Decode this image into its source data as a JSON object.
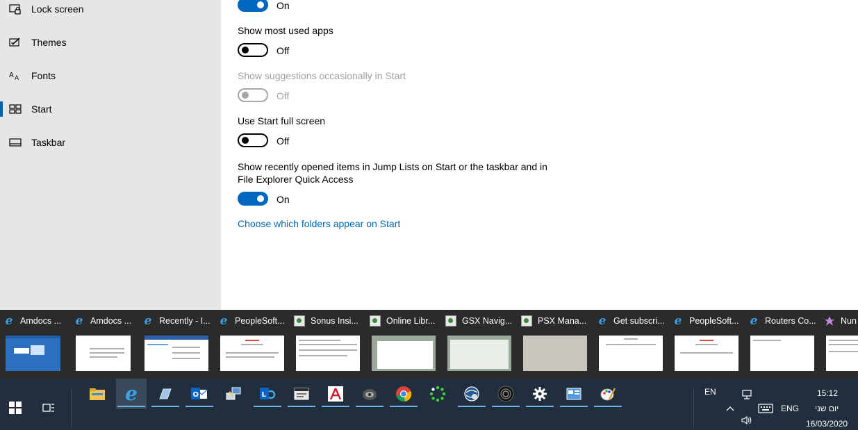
{
  "nav": {
    "items": [
      {
        "label": "Lock screen",
        "icon": "lock-screen-icon"
      },
      {
        "label": "Themes",
        "icon": "themes-icon"
      },
      {
        "label": "Fonts",
        "icon": "fonts-icon"
      },
      {
        "label": "Start",
        "icon": "start-icon",
        "active": true
      },
      {
        "label": "Taskbar",
        "icon": "taskbar-icon"
      }
    ]
  },
  "settings": {
    "top_toggle": {
      "state": "On"
    },
    "most_used": {
      "label": "Show most used apps",
      "state": "Off"
    },
    "suggestions": {
      "label": "Show suggestions occasionally in Start",
      "state": "Off",
      "disabled": true
    },
    "full_screen": {
      "label": "Use Start full screen",
      "state": "Off"
    },
    "jump_lists": {
      "label_line1": "Show recently opened items in Jump Lists on Start or the taskbar and in",
      "label_line2": "File Explorer Quick Access",
      "state": "On"
    },
    "folders_link": "Choose which folders appear on Start"
  },
  "thumbnails": [
    {
      "title": "Amdocs ...",
      "icon": "internet-explorer-icon"
    },
    {
      "title": "Amdocs ...",
      "icon": "internet-explorer-icon"
    },
    {
      "title": "Recently - I...",
      "icon": "internet-explorer-icon"
    },
    {
      "title": "PeopleSoft...",
      "icon": "internet-explorer-icon"
    },
    {
      "title": "Sonus Insi...",
      "icon": "sonus-icon"
    },
    {
      "title": "Online Libr...",
      "icon": "sonus-icon"
    },
    {
      "title": "GSX Navig...",
      "icon": "sonus-icon"
    },
    {
      "title": "PSX Mana...",
      "icon": "sonus-icon"
    },
    {
      "title": "Get subscri...",
      "icon": "internet-explorer-icon"
    },
    {
      "title": "PeopleSoft...",
      "icon": "internet-explorer-icon"
    },
    {
      "title": "Routers Co...",
      "icon": "internet-explorer-icon"
    },
    {
      "title": "Nun",
      "icon": "visual-studio-icon"
    }
  ],
  "taskbar": {
    "apps": [
      {
        "name": "file-explorer-icon"
      },
      {
        "name": "internet-explorer-icon",
        "active": true
      },
      {
        "name": "notes-app-icon"
      },
      {
        "name": "outlook-icon"
      },
      {
        "name": "remote-connection-icon"
      },
      {
        "name": "skype-for-business-icon"
      },
      {
        "name": "terminal-window-icon"
      },
      {
        "name": "adobe-acrobat-icon"
      },
      {
        "name": "helmet-app-icon"
      },
      {
        "name": "chrome-icon"
      },
      {
        "name": "dots-circle-icon"
      },
      {
        "name": "globe-app-icon"
      },
      {
        "name": "speaker-app-icon"
      },
      {
        "name": "settings-gear-icon"
      },
      {
        "name": "control-panel-icon"
      },
      {
        "name": "paint-icon"
      }
    ],
    "tray": {
      "lang_small": "EN",
      "lang": "ENG",
      "time": "15:12",
      "day": "יום שני",
      "date": "16/03/2020"
    }
  },
  "colors": {
    "accent": "#0067c0",
    "link": "#0067b8",
    "taskbar": "#202e3d",
    "thumb_strip": "#2b2b2b",
    "nav": "#e6e6e6"
  }
}
